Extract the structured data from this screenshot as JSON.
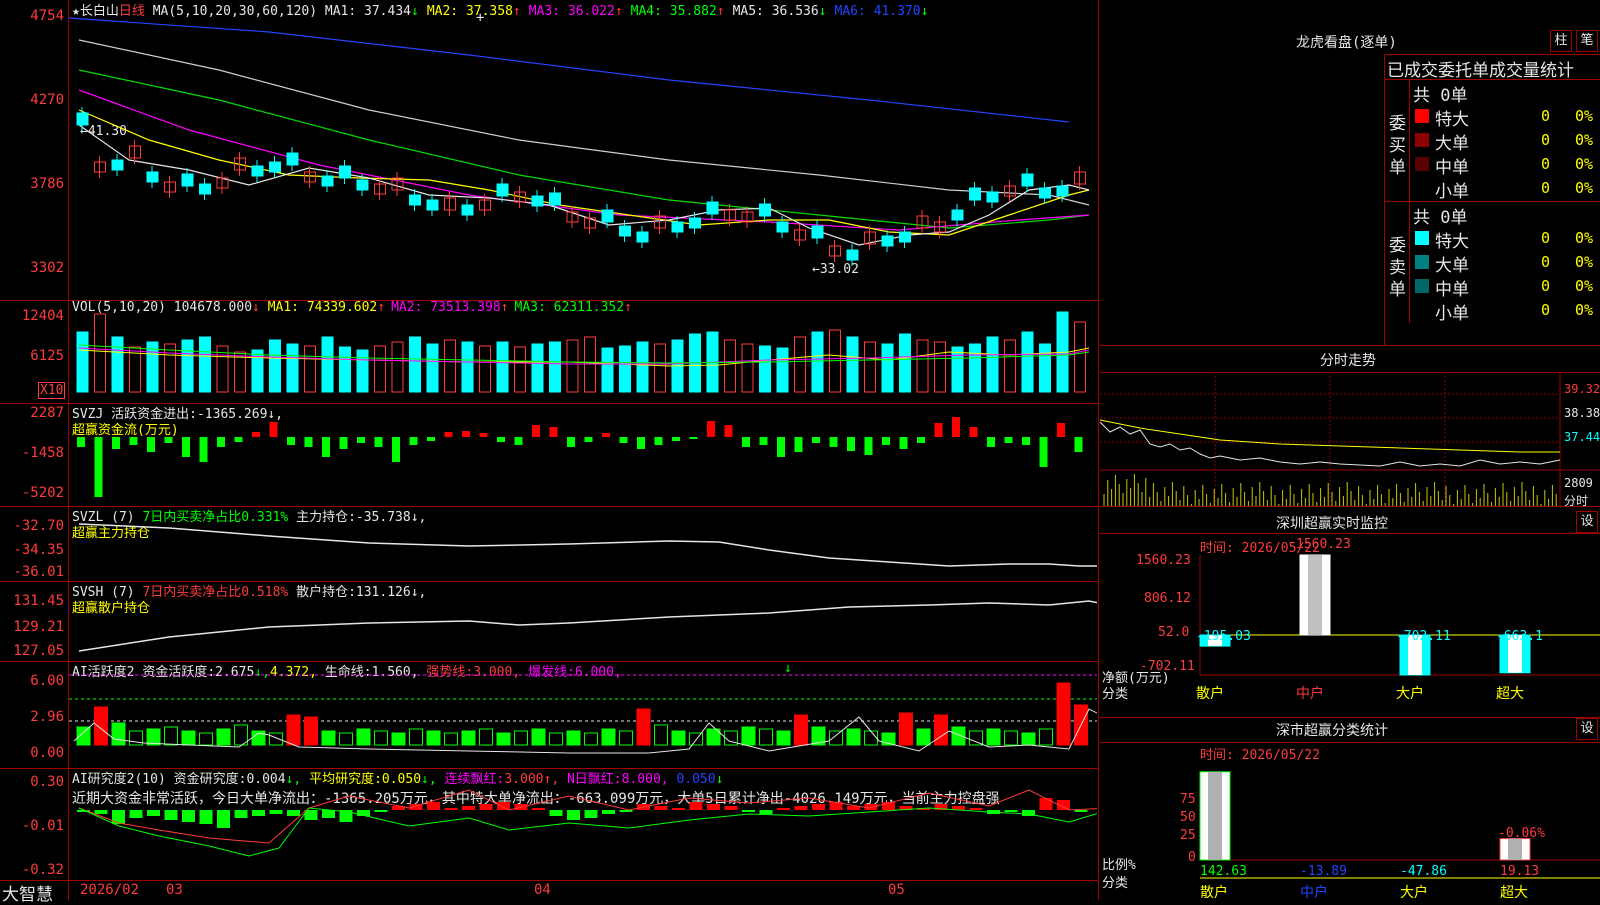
{
  "app": {
    "brand": "大智慧"
  },
  "main": {
    "kline": {
      "prefix": "★",
      "name": "长白山",
      "period": "日线",
      "ma_def": "MA(5,10,20,30,60,120)",
      "ma": [
        {
          "label": "MA1:",
          "value": "37.434",
          "arrow": "↓",
          "color": "#e6e6e6"
        },
        {
          "label": "MA2:",
          "value": "37.358",
          "arrow": "↑",
          "color": "#ffff00"
        },
        {
          "label": "MA3:",
          "value": "36.022",
          "arrow": "↑",
          "color": "#ff00ff"
        },
        {
          "label": "MA4:",
          "value": "35.882",
          "arrow": "↑",
          "color": "#00ff00"
        },
        {
          "label": "MA5:",
          "value": "36.536",
          "arrow": "↓",
          "color": "#e6e6e6"
        },
        {
          "label": "MA6:",
          "value": "41.370",
          "arrow": "↓",
          "color": "#2244ff"
        }
      ],
      "yticks": [
        "4754",
        "4270",
        "3786",
        "3302"
      ],
      "high_note": "←41.30",
      "low_note": "←33.02",
      "marker": "+"
    },
    "vol": {
      "def": "VOL(5,10,20)",
      "value": "104678.000",
      "arrow": "↓",
      "ma": [
        {
          "label": "MA1:",
          "value": "74339.602",
          "arrow": "↑",
          "color": "#ffff00"
        },
        {
          "label": "MA2:",
          "value": "73513.398",
          "arrow": "↑",
          "color": "#ff00ff"
        },
        {
          "label": "MA3:",
          "value": "62311.352",
          "arrow": "↑",
          "color": "#00ff00"
        }
      ],
      "yticks": [
        "12404",
        "6125"
      ],
      "unit_badge": "X10"
    },
    "svzj": {
      "title": "SVZJ",
      "label": "活跃资金进出:",
      "value": "-1365.269",
      "arrow": "↓,",
      "subtitle": "超赢资金流(万元)",
      "yticks": [
        "2287",
        "-1458",
        "-5202"
      ]
    },
    "svzl": {
      "title": "SVZL (7)",
      "pct_label": "7日内买卖净占比0.331%",
      "label": "主力持仓:",
      "value": "-35.738",
      "arrow": "↓,",
      "subtitle": "超赢主力持仓",
      "yticks": [
        "-32.70",
        "-34.35",
        "-36.01"
      ]
    },
    "svsh": {
      "title": "SVSH (7)",
      "pct_label": "7日内买卖净占比0.518%",
      "label": "散户持仓:",
      "value": "131.126",
      "arrow": "↓,",
      "subtitle": "超赢散户持仓",
      "yticks": [
        "131.45",
        "129.21",
        "127.05"
      ]
    },
    "ai_active": {
      "title": "AI活跃度2",
      "label": "资金活跃度:",
      "value": "2.675",
      "arrow": "↓,",
      "value2": "4.372,",
      "life_label": "生命线:",
      "life_value": "1.560,",
      "strong_label": "强势线:",
      "strong_value": "3.000,",
      "burst_label": "爆发线:",
      "burst_value": "6.000,",
      "arrow_marker": "↓",
      "yticks": [
        "6.00",
        "2.96",
        "0.00"
      ]
    },
    "ai_research": {
      "title": "AI研究度2(10)",
      "label": "资金研究度:",
      "value": "0.004",
      "arrow": "↓,",
      "avg_label": "平均研究度:",
      "avg_value": "0.050",
      "avg_arrow": "↓,",
      "streak_label": "连续飘红:",
      "streak_value": "3.000",
      "streak_arrow": "↑,",
      "n_label": "N日飘红:",
      "n_value": "8.000,",
      "n_value2": "0.050",
      "n_arrow": "↓",
      "note": "近期大资金非常活跃，今日大单净流出：-1365.205万元，其中特大单净流出：-663.099万元，大单5日累计净出-4026.149万元，当前主力控盘强",
      "yticks": [
        "0.30",
        "-0.01",
        "-0.32"
      ]
    },
    "dates": [
      "2026/02",
      "03",
      "04",
      "05"
    ]
  },
  "right": {
    "dragon": {
      "title": "龙虎看盘(逐单)",
      "btn1": "柱",
      "btn2": "笔",
      "header": "已成交委托单成交量统计",
      "buy_side": "委买单",
      "sell_side": "委卖单",
      "buy_total": "共 0单",
      "sell_total": "共 0单",
      "buy_rows": [
        {
          "label": "特大",
          "count": "0",
          "pct": "0%",
          "color": "#ff0000"
        },
        {
          "label": "大单",
          "count": "0",
          "pct": "0%",
          "color": "#8b0000"
        },
        {
          "label": "中单",
          "count": "0",
          "pct": "0%",
          "color": "#5a0000"
        },
        {
          "label": "小单",
          "count": "0",
          "pct": "0%",
          "color": "#000000"
        }
      ],
      "sell_rows": [
        {
          "label": "特大",
          "count": "0",
          "pct": "0%",
          "color": "#00ffff"
        },
        {
          "label": "大单",
          "count": "0",
          "pct": "0%",
          "color": "#008080"
        },
        {
          "label": "中单",
          "count": "0",
          "pct": "0%",
          "color": "#006666"
        },
        {
          "label": "小单",
          "count": "0",
          "pct": "0%",
          "color": "#000000"
        }
      ]
    },
    "intraday": {
      "title": "分时走势",
      "yticks": [
        "39.32",
        "38.38",
        "37.44"
      ],
      "vol_tick": "2809",
      "vol_unit": "分时"
    },
    "monitor": {
      "title": "深圳超赢实时监控",
      "btn": "设",
      "time_label": "时间: 2026/05/22",
      "yticks": [
        "1560.23",
        "806.12",
        "52.0",
        "-702.11"
      ],
      "y_unit": "净额(万元)",
      "x_title": "分类",
      "categories": [
        "散户",
        "中户",
        "大户",
        "超大"
      ],
      "values": [
        "-195.03",
        "1560.23",
        "-702.11",
        "-663.1"
      ]
    },
    "classify": {
      "title": "深市超赢分类统计",
      "btn": "设",
      "time_label": "时间: 2026/05/22",
      "yticks": [
        "75",
        "50",
        "25",
        "0"
      ],
      "y_unit": "比例%",
      "x_title": "分类",
      "categories": [
        "散户",
        "中户",
        "大户",
        "超大"
      ],
      "values": [
        "142.63",
        "-13.89",
        "-47.86",
        "19.13"
      ],
      "extra_label": "-0.06%"
    }
  },
  "chart_data": [
    {
      "type": "bar",
      "title": "深圳超赢实时监控",
      "ylabel": "净额(万元)",
      "categories": [
        "散户",
        "中户",
        "大户",
        "超大"
      ],
      "values": [
        -195.03,
        1560.23,
        -702.11,
        -663.1
      ],
      "ylim": [
        -702.11,
        1560.23
      ]
    },
    {
      "type": "bar",
      "title": "深市超赢分类统计",
      "ylabel": "比例%",
      "categories": [
        "散户",
        "中户",
        "大户",
        "超大"
      ],
      "values": [
        142.63,
        -13.89,
        -47.86,
        19.13
      ],
      "ylim": [
        0,
        75
      ]
    },
    {
      "type": "line",
      "title": "长白山 日线",
      "series": [
        {
          "name": "MA6",
          "values": [
            45.8,
            45.4,
            45.0,
            44.5,
            44.0,
            43.5,
            43.0,
            42.5,
            42.0,
            41.8,
            41.5,
            41.37
          ]
        },
        {
          "name": "MA5",
          "values": [
            43.9,
            43.2,
            42.4,
            41.6,
            40.8,
            40.0,
            39.3,
            38.7,
            38.0,
            37.2,
            36.6,
            36.54
          ]
        }
      ]
    }
  ]
}
